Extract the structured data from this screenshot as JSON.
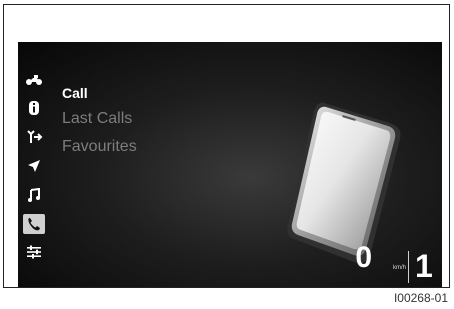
{
  "menu": {
    "items": [
      {
        "label": "Call",
        "selected": true
      },
      {
        "label": "Last Calls",
        "selected": false
      },
      {
        "label": "Favourites",
        "selected": false
      }
    ]
  },
  "sidebar": {
    "icons": [
      {
        "name": "motorcycle-icon",
        "active": false
      },
      {
        "name": "info-icon",
        "active": false
      },
      {
        "name": "bluetooth-icon",
        "active": false
      },
      {
        "name": "navigation-arrow-icon",
        "active": false
      },
      {
        "name": "music-note-icon",
        "active": false
      },
      {
        "name": "phone-icon",
        "active": true
      },
      {
        "name": "settings-sliders-icon",
        "active": false
      }
    ]
  },
  "status": {
    "speed": "0",
    "speed_unit": "km/h",
    "gear": "1"
  },
  "caption": "I00268-01",
  "colors": {
    "screen_bg": "#111111",
    "selected_text": "#ffffff",
    "dim_text": "#7d7d7d",
    "active_icon_bg": "#d0d0d0"
  }
}
